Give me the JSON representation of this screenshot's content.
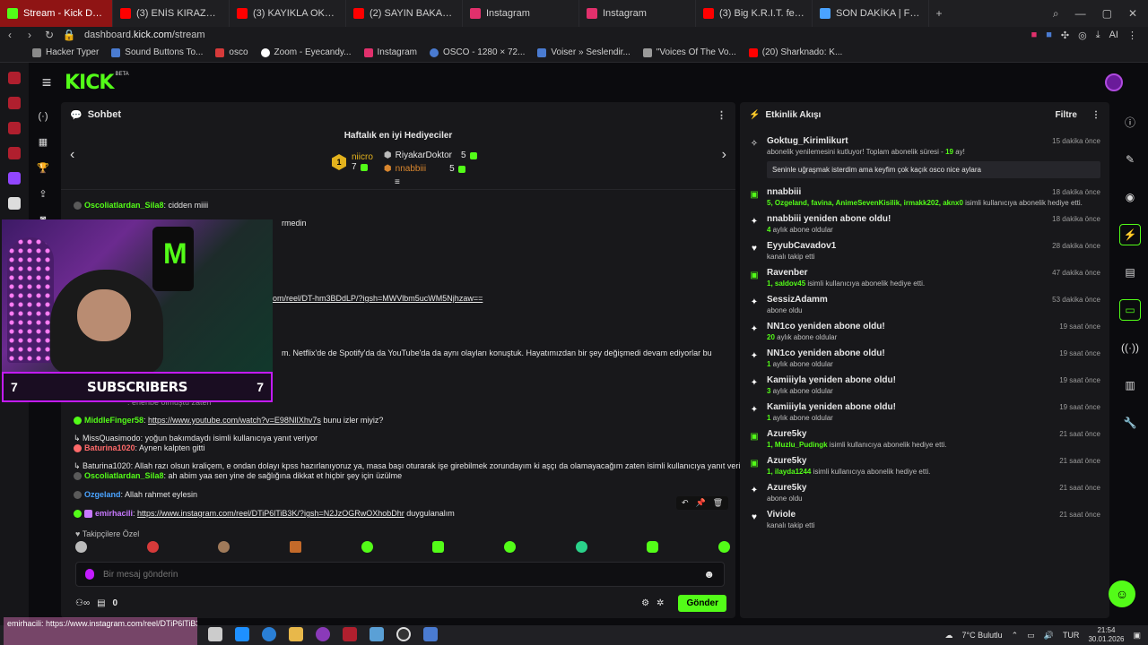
{
  "browser": {
    "tabs": [
      {
        "title": "Stream - Kick Dashboard",
        "active": true,
        "color": "#53fc18"
      },
      {
        "title": "(3) ENİS KIRAZOĞLU OYU",
        "color": "#ff0000"
      },
      {
        "title": "(3) KAYIKLA OKYANUSU",
        "color": "#ff0000"
      },
      {
        "title": "(2) SAYIN BAKANIM BU",
        "color": "#ff0000"
      },
      {
        "title": "Instagram",
        "color": "#e1306c"
      },
      {
        "title": "Instagram",
        "color": "#e1306c"
      },
      {
        "title": "(3) Big K.R.I.T. feat. A$AP",
        "color": "#ff0000"
      },
      {
        "title": "SON DAKİKA | Fatih Ürek",
        "color": "#4aa3ff"
      }
    ],
    "new_tab": "+",
    "url_prefix": "dashboard.",
    "url_host": "kick.com",
    "url_path": "/stream",
    "ai_label": "AI",
    "bookmarks": [
      {
        "label": "Hacker Typer",
        "color": "#8a8a8a"
      },
      {
        "label": "Sound Buttons To...",
        "color": "#4a7bd1"
      },
      {
        "label": "osco",
        "color": "#d63a3a"
      },
      {
        "label": "Zoom - Eyecandy...",
        "color": "#ffffff"
      },
      {
        "label": "Instagram",
        "color": "#e1306c"
      },
      {
        "label": "OSCO - 1280 × 72...",
        "color": "#4a7bd1"
      },
      {
        "label": "Voiser » Seslendir...",
        "color": "#4a7bd1"
      },
      {
        "label": "\"Voices Of The Vo...",
        "color": "#9a9a9a"
      },
      {
        "label": "(20) Sharknado: K...",
        "color": "#ff0000"
      }
    ]
  },
  "kick": {
    "logo": "KICK",
    "beta": "BETA"
  },
  "chat": {
    "title": "Sohbet",
    "gifters_title": "Haftalık en iyi Hediyeciler",
    "top_gifter": {
      "rank": "1",
      "name": "niicro",
      "count": "7"
    },
    "gifter2": {
      "name": "RiyakarDoktor",
      "count": "5"
    },
    "gifter3": {
      "name": "nnabbiii",
      "count": "5"
    },
    "messages": [
      {
        "user": "Oscoliatlardan_Sila8",
        "text": ": cidden miiii",
        "color": "#53fc18"
      },
      {
        "text": "rmedin"
      },
      {
        "link": "om/reel/DT-hm3BDdLP/?igsh=MWVlbm5ucWM5Njhzaw=="
      },
      {
        "text": "m. Netflix'de de Spotify'da da YouTube'da da aynı olayları konuştuk. Hayatımızdan bir şey değişmedi devam ediyorlar bu"
      },
      {
        "text": ": erlenbe olmuştu zaten"
      },
      {
        "user": "MiddleFinger58",
        "link": "https://www.youtube.com/watch?v=E98NlIXhv7s",
        "text": " bunu izler miyiz?",
        "color": "#53fc18"
      },
      {
        "reply": "MissQuasimodo: yoğun bakımdaydı isimli kullanıcıya yanıt veriyor"
      },
      {
        "user": "Baturina1020",
        "text": ": Aynen kalpten gitti",
        "color": "#ff6a6a"
      },
      {
        "reply": "Baturina1020: Allah razı olsun kraliçem, e ondan dolayı kpss hazırlanıyoruz ya, masa başı oturarak işe girebilmek zorundayım ki aşçı da olamayacağım zaten isimli kullanıcıya yanıt veriyor"
      },
      {
        "user": "Oscoliatlardan_Sila8",
        "text": ": ah abim yaa sen yine de sağlığına dikkat et hiçbir şey için üzülme",
        "color": "#53fc18"
      },
      {
        "user": "Ozgeland",
        "text": ": Allah rahmet eylesin",
        "color": "#4aa3ff"
      },
      {
        "user": "emirhacili",
        "link": "https://www.instagram.com/reel/DTiP6lTiB3K/?igsh=N2JzOGRwOXhobDhr",
        "text": " duygulanalım",
        "color": "#c879ff"
      }
    ],
    "follow_only": "Takipçilere Özel",
    "input_placeholder": "Bir mesaj gönderin",
    "points": "0",
    "send_label": "Gönder"
  },
  "webcam": {
    "subs_left": "7",
    "subs_label": "SUBSCRIBERS",
    "subs_right": "7"
  },
  "activity": {
    "title": "Etkinlik Akışı",
    "filter_label": "Filtre",
    "items": [
      {
        "title": "Goktug_Kirimlikurt",
        "sub_pre": "abonelik yenilemesini kutluyor! Toplam abonelik süresi - ",
        "sub_hl": "19",
        "sub_post": " ay!",
        "time": "15 dakika önce",
        "quote": "Seninle uğraşmak isterdim ama keyfim çok kaçık osco nice aylara",
        "icon": "confetti"
      },
      {
        "title": "nnabbiii",
        "sub_hl": "5, Ozgeland, favina, AnimeSevenKisilik, irmakk202, aknx0",
        "sub_post": " isimli kullanıcıya abonelik hediye etti.",
        "time": "18 dakika önce",
        "icon": "gift"
      },
      {
        "title": "nnabbiii yeniden abone oldu!",
        "sub_hl": "4",
        "sub_post": " aylık abone oldular",
        "time": "18 dakika önce",
        "icon": "star"
      },
      {
        "title": "EyyubCavadov1",
        "sub_post": "kanalı takip etti",
        "time": "28 dakika önce",
        "icon": "heart"
      },
      {
        "title": "Ravenber",
        "sub_hl": "1, saldov45",
        "sub_post": " isimli kullanıcıya abonelik hediye etti.",
        "time": "47 dakika önce",
        "icon": "gift"
      },
      {
        "title": "SessizAdamm",
        "sub_post": "abone oldu",
        "time": "53 dakika önce",
        "icon": "star"
      },
      {
        "title": "NN1co yeniden abone oldu!",
        "sub_hl": "20",
        "sub_post": " aylık abone oldular",
        "time": "19 saat önce",
        "icon": "star"
      },
      {
        "title": "NN1co yeniden abone oldu!",
        "sub_hl": "1",
        "sub_post": " aylık abone oldular",
        "time": "19 saat önce",
        "icon": "star"
      },
      {
        "title": "Kamiiiyla yeniden abone oldu!",
        "sub_hl": "3",
        "sub_post": " aylık abone oldular",
        "time": "19 saat önce",
        "icon": "star"
      },
      {
        "title": "Kamiiiyla yeniden abone oldu!",
        "sub_hl": "1",
        "sub_post": " aylık abone oldular",
        "time": "19 saat önce",
        "icon": "star"
      },
      {
        "title": "Azure5ky",
        "sub_hl": "1, Muzlu_Pudingk",
        "sub_post": " isimli kullanıcıya abonelik hediye etti.",
        "time": "21 saat önce",
        "icon": "gift"
      },
      {
        "title": "Azure5ky",
        "sub_hl": "1, ilayda1244",
        "sub_post": " isimli kullanıcıya abonelik hediye etti.",
        "time": "21 saat önce",
        "icon": "gift"
      },
      {
        "title": "Azure5ky",
        "sub_post": "abone oldu",
        "time": "21 saat önce",
        "icon": "star"
      },
      {
        "title": "Viviole",
        "sub_post": "kanalı takip etti",
        "time": "21 saat önce",
        "icon": "heart"
      }
    ]
  },
  "taskbar": {
    "overlay_text": "emirhacili: https://www.instagram.com/reel/DTiP6lTiB3K/?igsh=N2JzOGRwOXhobDhr duygulanalım",
    "weather": "7°C  Bulutlu",
    "lang": "TUR",
    "time": "21:54",
    "date": "30.01.2026"
  },
  "colors": {
    "kick_green": "#53fc18",
    "sub_purple": "#c31bff"
  }
}
